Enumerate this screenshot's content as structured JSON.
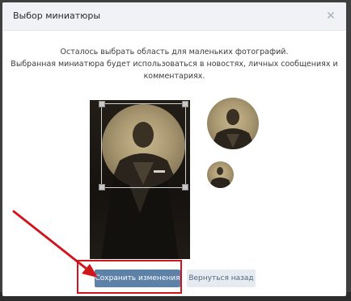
{
  "dialog": {
    "title": "Выбор миниатюры",
    "close_icon": "close-icon",
    "instructions": {
      "line1": "Осталось выбрать область для маленьких фотографий.",
      "line2": "Выбранная миниатюра будет использоваться в новостях, личных сообщениях и",
      "line3": "комментариях."
    },
    "buttons": {
      "save_label": "Сохранить изменения",
      "back_label": "Вернуться назад"
    }
  },
  "colors": {
    "primary_button": "#5e81a8",
    "secondary_button": "#e5ebf1",
    "annotation": "#d0161d"
  }
}
